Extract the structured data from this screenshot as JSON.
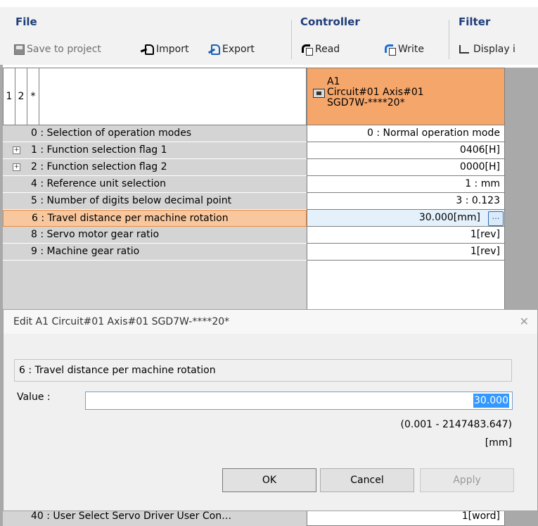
{
  "ribbon": {
    "groups": [
      {
        "title": "File"
      },
      {
        "title": "Controller"
      },
      {
        "title": "Filter"
      }
    ],
    "buttons": {
      "save": "Save to project",
      "import": "Import",
      "export": "Export",
      "read": "Read",
      "write": "Write",
      "display": "Display i"
    }
  },
  "grid": {
    "header_cols": [
      "1",
      "2",
      "*"
    ],
    "axis": {
      "name": "A1",
      "circuit": "Circuit#01 Axis#01",
      "model": "SGD7W-****20*"
    },
    "rows": [
      {
        "name": "0 : Selection of operation modes",
        "value": "0 : Normal operation mode",
        "expandable": false
      },
      {
        "name": "1 : Function selection flag 1",
        "value": "0406[H]",
        "expandable": true
      },
      {
        "name": "2 : Function selection flag 2",
        "value": "0000[H]",
        "expandable": true
      },
      {
        "name": "4 : Reference unit selection",
        "value": "1 : mm",
        "expandable": false
      },
      {
        "name": "5 : Number of digits below decimal point",
        "value": "3 : 0.123",
        "expandable": false
      },
      {
        "name": "6 : Travel distance per machine rotation",
        "value": "30.000[mm]",
        "expandable": false,
        "selected": true
      },
      {
        "name": "8 : Servo motor gear ratio",
        "value": "1[rev]",
        "expandable": false
      },
      {
        "name": "9 : Machine gear ratio",
        "value": "1[rev]",
        "expandable": false
      }
    ],
    "bottom_row": {
      "name": "40 : User Select Servo Driver User Con…",
      "value": "1[word]"
    }
  },
  "dialog": {
    "title": "Edit  A1  Circuit#01  Axis#01  SGD7W-****20*",
    "param": "6 : Travel distance per machine rotation",
    "value_label": "Value :",
    "value": "30.000",
    "range": "(0.001 - 2147483.647)",
    "unit": "[mm]",
    "ok": "OK",
    "cancel": "Cancel",
    "apply": "Apply"
  }
}
